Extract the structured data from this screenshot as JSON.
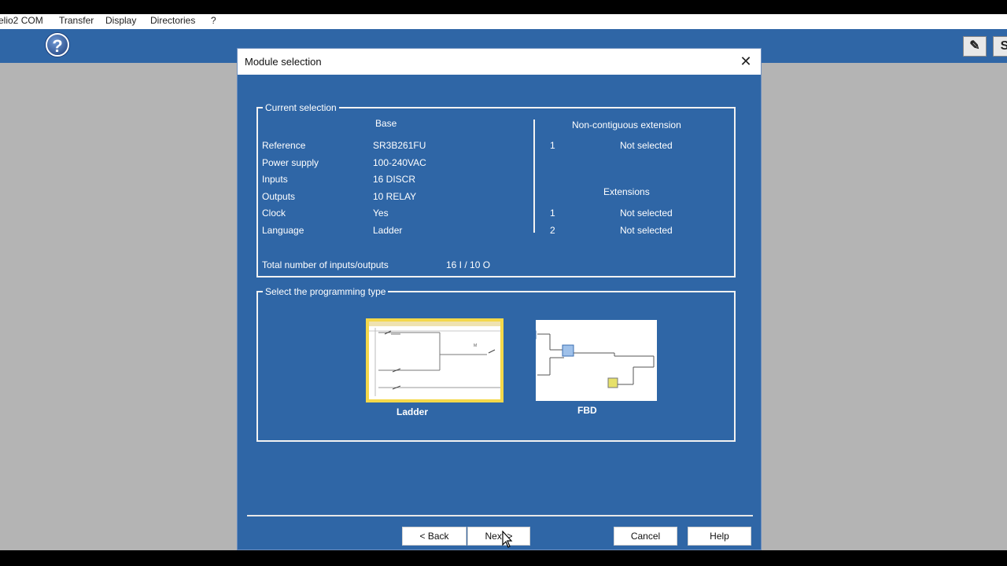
{
  "app": {
    "menus": [
      "elio2 COM",
      "Transfer",
      "Display",
      "Directories",
      "?"
    ],
    "help_glyph": "?",
    "toolbar_right_glyph_1": "✎",
    "toolbar_right_glyph_2": "S"
  },
  "dialog": {
    "title": "Module selection",
    "close_glyph": "✕",
    "current_selection": {
      "legend": "Current selection",
      "base_header": "Base",
      "rows": [
        {
          "label": "Reference",
          "value": "SR3B261FU"
        },
        {
          "label": "Power supply",
          "value": "100-240VAC"
        },
        {
          "label": "Inputs",
          "value": "16 DISCR"
        },
        {
          "label": "Outputs",
          "value": "10 RELAY"
        },
        {
          "label": "Clock",
          "value": "Yes"
        },
        {
          "label": "Language",
          "value": "Ladder"
        }
      ],
      "total_label": "Total number of inputs/outputs",
      "total_value": "16 I / 10 O",
      "non_contiguous_header": "Non-contiguous extension",
      "non_contiguous": [
        {
          "index": "1",
          "status": "Not selected"
        }
      ],
      "extensions_header": "Extensions",
      "extensions": [
        {
          "index": "1",
          "status": "Not selected"
        },
        {
          "index": "2",
          "status": "Not selected"
        }
      ]
    },
    "programming_type": {
      "legend": "Select the programming type",
      "options": [
        {
          "label": "Ladder",
          "selected": true
        },
        {
          "label": "FBD",
          "selected": false
        }
      ]
    },
    "buttons": {
      "back": "< Back",
      "next": "Next >",
      "cancel": "Cancel",
      "help": "Help"
    }
  },
  "colors": {
    "dialog_bg": "#2f66a6",
    "workspace_bg": "#b4b4b4",
    "selection_highlight": "#f4d84a"
  }
}
